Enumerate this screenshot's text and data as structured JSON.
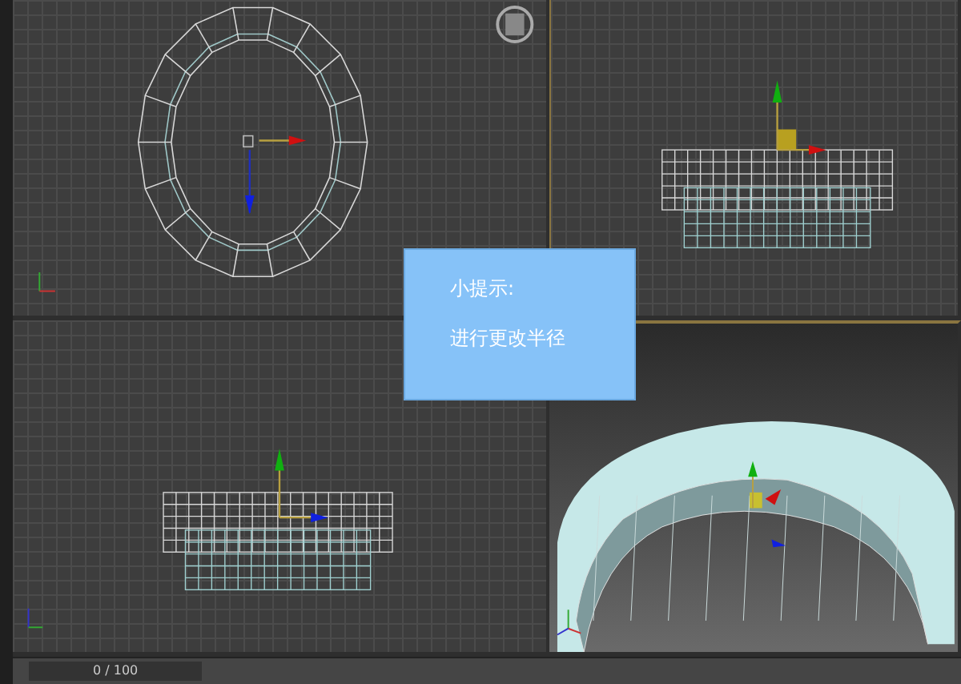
{
  "viewports": [
    {
      "kind": "top"
    },
    {
      "kind": "front"
    },
    {
      "kind": "left"
    },
    {
      "kind": "perspective"
    }
  ],
  "tooltip": {
    "title": "小提示:",
    "message": "进行更改半径"
  },
  "timeline": {
    "frame": "0 / 100",
    "level": 0
  }
}
